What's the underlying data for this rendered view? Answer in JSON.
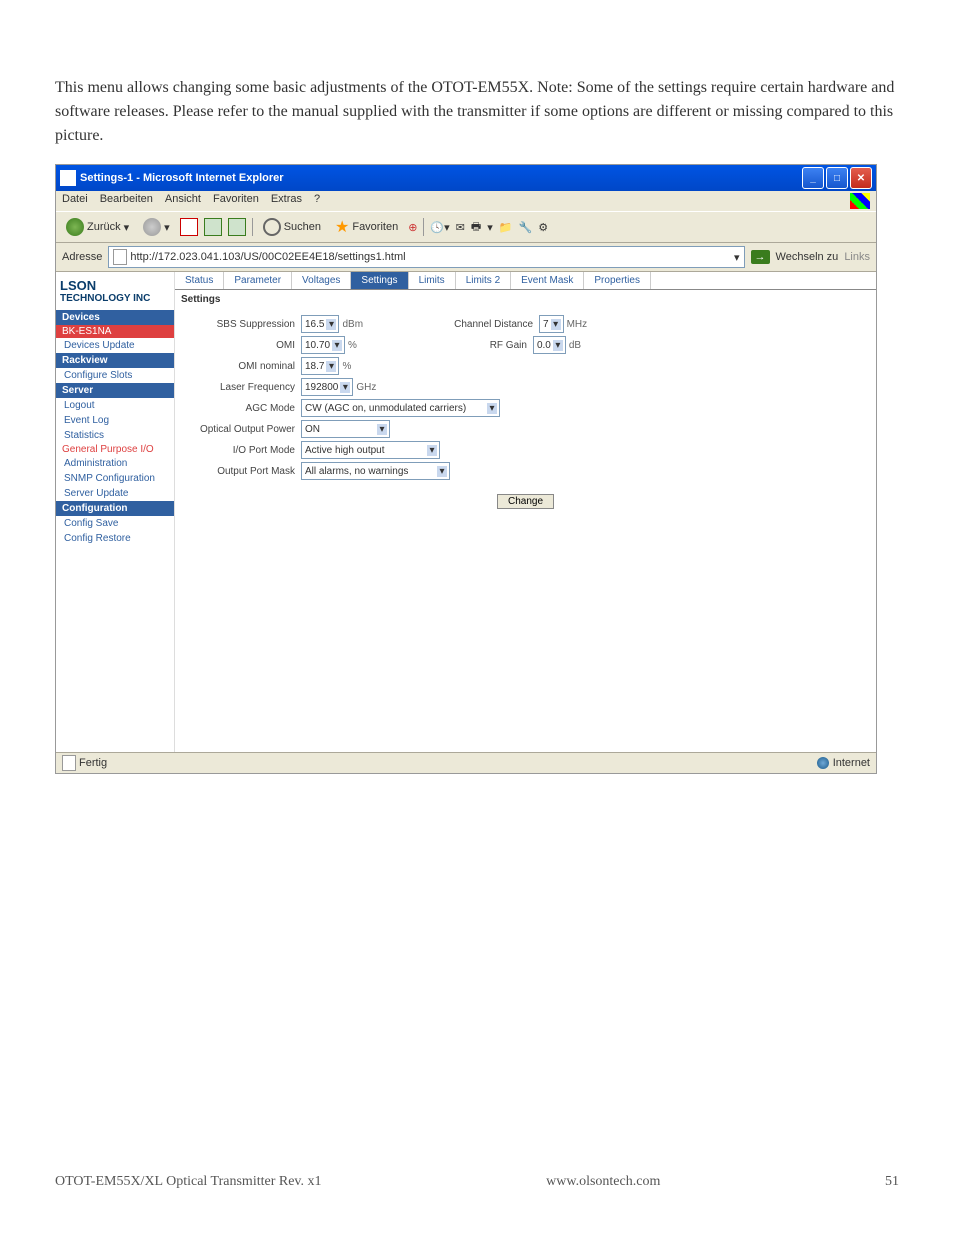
{
  "body_text": "This menu allows changing some basic adjustments of the OTOT-EM55X. Note: Some of the settings require certain hardware and software releases. Please refer to the manual supplied with the transmitter if some options are different or missing compared to this picture.",
  "window": {
    "title": "Settings-1 - Microsoft Internet Explorer"
  },
  "menubar": {
    "datei": "Datei",
    "bearbeiten": "Bearbeiten",
    "ansicht": "Ansicht",
    "favoriten": "Favoriten",
    "extras": "Extras",
    "hilfe": "?"
  },
  "toolbar": {
    "back": "Zurück",
    "forward": "",
    "search": "Suchen",
    "favorites": "Favoriten"
  },
  "addressbar": {
    "label": "Adresse",
    "url": "http://172.023.041.103/US/00C02EE4E18/settings1.html",
    "go": "Wechseln zu",
    "links": "Links"
  },
  "logo": {
    "olson": "LSON",
    "tech": "TECHNOLOGY INC"
  },
  "sidebar": {
    "h1": "Devices",
    "i1": "BK-ES1NA",
    "i2": "Devices Update",
    "h2": "Rackview",
    "i3": "Configure Slots",
    "h3": "Server",
    "i4": "Logout",
    "i5": "Event Log",
    "i6": "Statistics",
    "i7": "General Purpose I/O",
    "i8": "Administration",
    "i9": "SNMP Configuration",
    "i10": "Server Update",
    "h4": "Configuration",
    "i11": "Config Save",
    "i12": "Config Restore"
  },
  "tabs": {
    "t1": "Status",
    "t2": "Parameter",
    "t3": "Voltages",
    "t4": "Settings",
    "t5": "Limits",
    "t6": "Limits 2",
    "t7": "Event Mask",
    "t8": "Properties"
  },
  "section": "Settings",
  "form": {
    "sbs_label": "SBS Suppression",
    "sbs_value": "16.5",
    "sbs_unit": "dBm",
    "cd_label": "Channel Distance",
    "cd_value": "7",
    "cd_unit": "MHz",
    "omi_label": "OMI",
    "omi_value": "10.70",
    "omi_unit": "%",
    "rfgain_label": "RF Gain",
    "rfgain_value": "0.0",
    "rfgain_unit": "dB",
    "omin_label": "OMI nominal",
    "omin_value": "18.7",
    "omin_unit": "%",
    "laser_label": "Laser Frequency",
    "laser_value": "192800",
    "laser_unit": "GHz",
    "agc_label": "AGC Mode",
    "agc_value": "CW (AGC on, unmodulated carriers)",
    "oop_label": "Optical Output Power",
    "oop_value": "ON",
    "io_label": "I/O Port Mode",
    "io_value": "Active high output",
    "mask_label": "Output Port Mask",
    "mask_value": "All alarms, no warnings",
    "change": "Change"
  },
  "status": {
    "fertig": "Fertig",
    "internet": "Internet"
  },
  "footer": {
    "left": "OTOT-EM55X/XL Optical Transmitter Rev. x1",
    "center": "www.olsontech.com",
    "right": "51"
  }
}
